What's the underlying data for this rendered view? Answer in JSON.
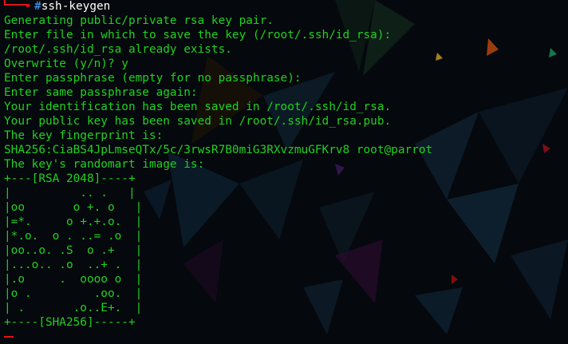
{
  "terminal": {
    "prompt": {
      "symbol": "#",
      "command": "ssh-keygen"
    },
    "lines": [
      "Generating public/private rsa key pair.",
      "Enter file in which to save the key (/root/.ssh/id_rsa):",
      "/root/.ssh/id_rsa already exists.",
      "Overwrite (y/n)? y",
      "Enter passphrase (empty for no passphrase):",
      "Enter same passphrase again:",
      "Your identification has been saved in /root/.ssh/id_rsa.",
      "Your public key has been saved in /root/.ssh/id_rsa.pub.",
      "The key fingerprint is:",
      "SHA256:CiaBS4JpLmseQTx/5c/3rwsR7B0miG3RXvzmuGFKrv8 root@parrot",
      "The key's randomart image is:",
      "+---[RSA 2048]----+",
      "|          .. .   |",
      "|oo       o +. o   |",
      "|=*.     o +.+.o.  |",
      "|*.o.  o . ..= .o  |",
      "|oo..o. .S  o .+   |",
      "|...o.. .o  ..+ .  |",
      "|.o     .  oooo o  |",
      "|o .         .oo.  |",
      "| .       .o..E+.  |",
      "+----[SHA256]-----+"
    ]
  },
  "colors": {
    "text": "#1fd21f",
    "prompt_decor": "#e01515",
    "prompt_hash": "#4aa3ff",
    "command": "#ffffff",
    "background": "#05080c"
  }
}
